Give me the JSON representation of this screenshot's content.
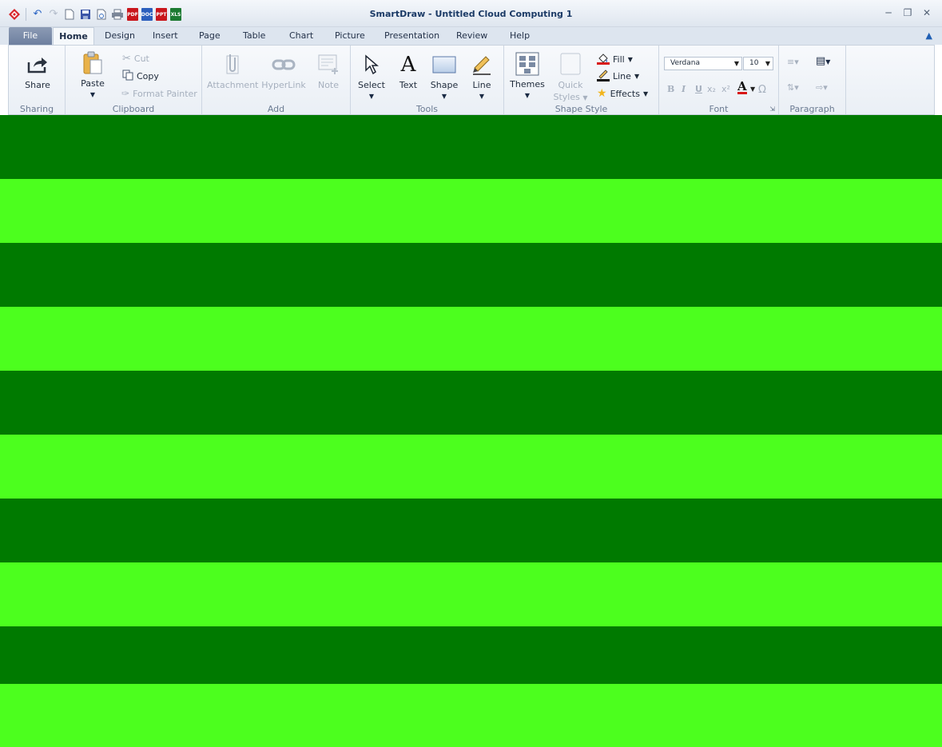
{
  "window": {
    "title": "SmartDraw - Untitled Cloud Computing 1"
  },
  "qat": {
    "pdf": "PDF",
    "doc": "DOC",
    "ppt": "PPT",
    "xls": "XLS",
    "icons": [
      "app-logo-icon",
      "undo-icon",
      "redo-icon",
      "new-icon",
      "save-icon",
      "print-preview-icon",
      "print-icon",
      "export-pdf-icon",
      "export-doc-icon",
      "export-ppt-icon",
      "export-xls-icon"
    ]
  },
  "tabs": [
    "File",
    "Home",
    "Design",
    "Insert",
    "Page",
    "Table",
    "Chart",
    "Picture",
    "Presentation",
    "Review",
    "Help"
  ],
  "ribbon": {
    "sharing": {
      "label": "Sharing",
      "share": "Share"
    },
    "clipboard": {
      "label": "Clipboard",
      "paste": "Paste",
      "cut": "Cut",
      "copy": "Copy",
      "format_painter": "Format Painter"
    },
    "add": {
      "label": "Add",
      "attachment": "Attachment",
      "hyperlink": "HyperLink",
      "note": "Note"
    },
    "tools": {
      "label": "Tools",
      "select": "Select",
      "text": "Text",
      "shape": "Shape",
      "line": "Line"
    },
    "shape_style": {
      "label": "Shape Style",
      "themes": "Themes",
      "quick_1": "Quick",
      "quick_2": "Styles",
      "fill": "Fill",
      "line": "Line",
      "effects": "Effects"
    },
    "font": {
      "label": "Font",
      "family": "Verdana",
      "size": "10"
    },
    "paragraph": {
      "label": "Paragraph"
    }
  },
  "canvas": {
    "dark_color": "#007a00",
    "light_color": "#4cff1e"
  }
}
